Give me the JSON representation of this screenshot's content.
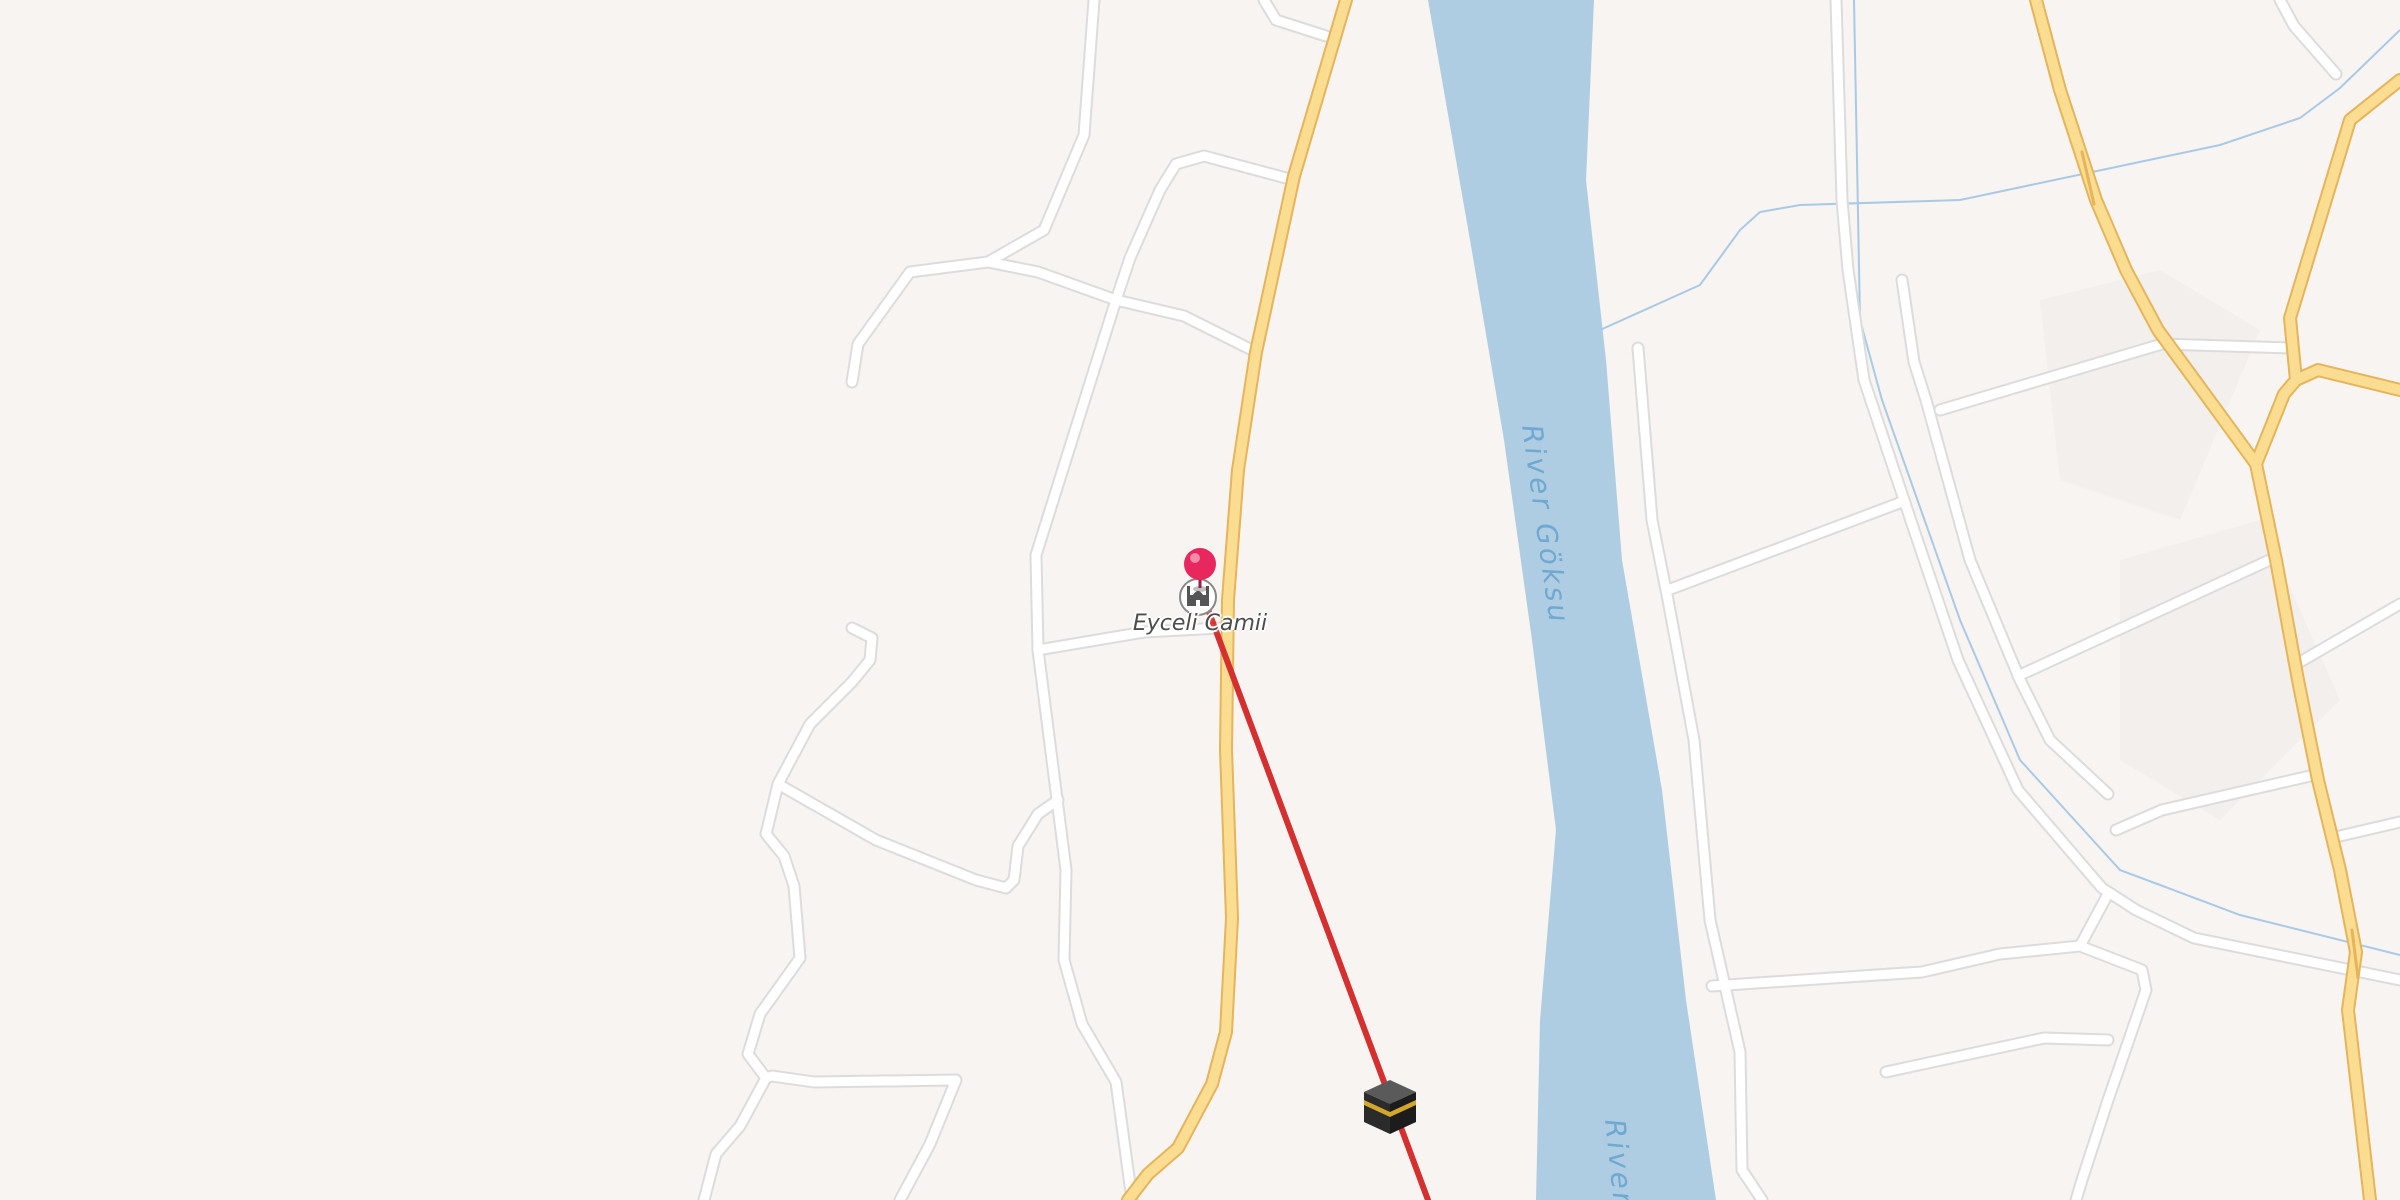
{
  "map": {
    "labels": {
      "poi": "Eyceli Camii",
      "river_main": "River Göksu",
      "river_lower": "River"
    },
    "route": {
      "color": "#d62f2f"
    },
    "colors": {
      "land": "#f7f4f1",
      "water": "#aecde2",
      "primary_road": "#fbdd92",
      "minor_road": "#ffffff",
      "pin": "#e8275f"
    },
    "icons": {
      "pin": "map-pin-icon",
      "mosque": "mosque-icon",
      "kaaba": "kaaba-icon"
    }
  }
}
